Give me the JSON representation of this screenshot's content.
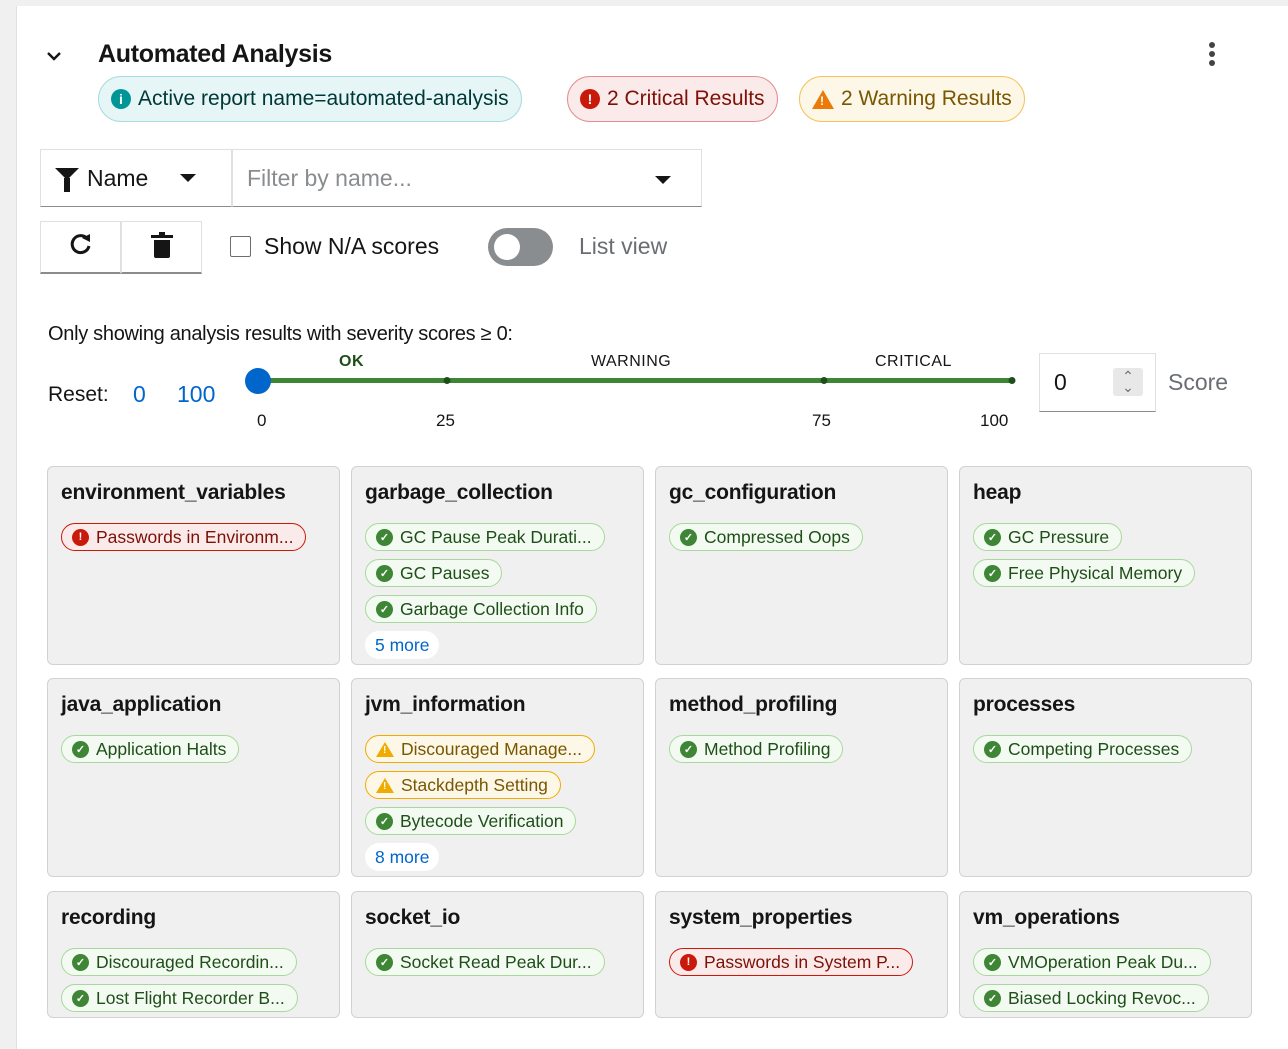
{
  "header": {
    "title": "Automated Analysis",
    "labels": {
      "info": "Active report name=automated-analysis",
      "critical": "2 Critical Results",
      "warning": "2 Warning Results"
    }
  },
  "toolbar": {
    "filter_attribute": "Name",
    "filter_placeholder": "Filter by name...",
    "show_na_label": "Show N/A scores",
    "list_view_label": "List view",
    "show_na_checked": false,
    "list_view_on": false
  },
  "severity": {
    "description": "Only showing analysis results with severity scores ≥ 0:",
    "reset_label": "Reset:",
    "reset_min": "0",
    "reset_max": "100",
    "bands": [
      "OK",
      "WARNING",
      "CRITICAL"
    ],
    "ticks": [
      "0",
      "25",
      "75",
      "100"
    ],
    "slider_value": 0,
    "score_value": "0",
    "score_label": "Score"
  },
  "categories": [
    {
      "name": "environment_variables",
      "results": [
        {
          "sev": "crit",
          "text": "Passwords in Environm..."
        }
      ]
    },
    {
      "name": "garbage_collection",
      "results": [
        {
          "sev": "ok",
          "text": "GC Pause Peak Durati..."
        },
        {
          "sev": "ok",
          "text": "GC Pauses"
        },
        {
          "sev": "ok",
          "text": "Garbage Collection Info"
        }
      ],
      "more": "5 more"
    },
    {
      "name": "gc_configuration",
      "results": [
        {
          "sev": "ok",
          "text": "Compressed Oops"
        }
      ]
    },
    {
      "name": "heap",
      "results": [
        {
          "sev": "ok",
          "text": "GC Pressure"
        },
        {
          "sev": "ok",
          "text": "Free Physical Memory"
        }
      ]
    },
    {
      "name": "java_application",
      "results": [
        {
          "sev": "ok",
          "text": "Application Halts"
        }
      ]
    },
    {
      "name": "jvm_information",
      "results": [
        {
          "sev": "warn",
          "text": "Discouraged Manage..."
        },
        {
          "sev": "warn",
          "text": "Stackdepth Setting"
        },
        {
          "sev": "ok",
          "text": "Bytecode Verification"
        }
      ],
      "more": "8 more"
    },
    {
      "name": "method_profiling",
      "results": [
        {
          "sev": "ok",
          "text": "Method Profiling"
        }
      ]
    },
    {
      "name": "processes",
      "results": [
        {
          "sev": "ok",
          "text": "Competing Processes"
        }
      ]
    },
    {
      "name": "recording",
      "results": [
        {
          "sev": "ok",
          "text": "Discouraged Recordin..."
        },
        {
          "sev": "ok",
          "text": "Lost Flight Recorder B..."
        }
      ]
    },
    {
      "name": "socket_io",
      "results": [
        {
          "sev": "ok",
          "text": "Socket Read Peak Dur..."
        }
      ]
    },
    {
      "name": "system_properties",
      "results": [
        {
          "sev": "crit",
          "text": "Passwords in System P..."
        }
      ]
    },
    {
      "name": "vm_operations",
      "results": [
        {
          "sev": "ok",
          "text": "VMOperation Peak Du..."
        },
        {
          "sev": "ok",
          "text": "Biased Locking Revoc..."
        }
      ]
    }
  ],
  "colors": {
    "accent": "#0066cc",
    "ok": "#3e8635",
    "critical": "#c9190b",
    "warning": "#f0ab00"
  }
}
